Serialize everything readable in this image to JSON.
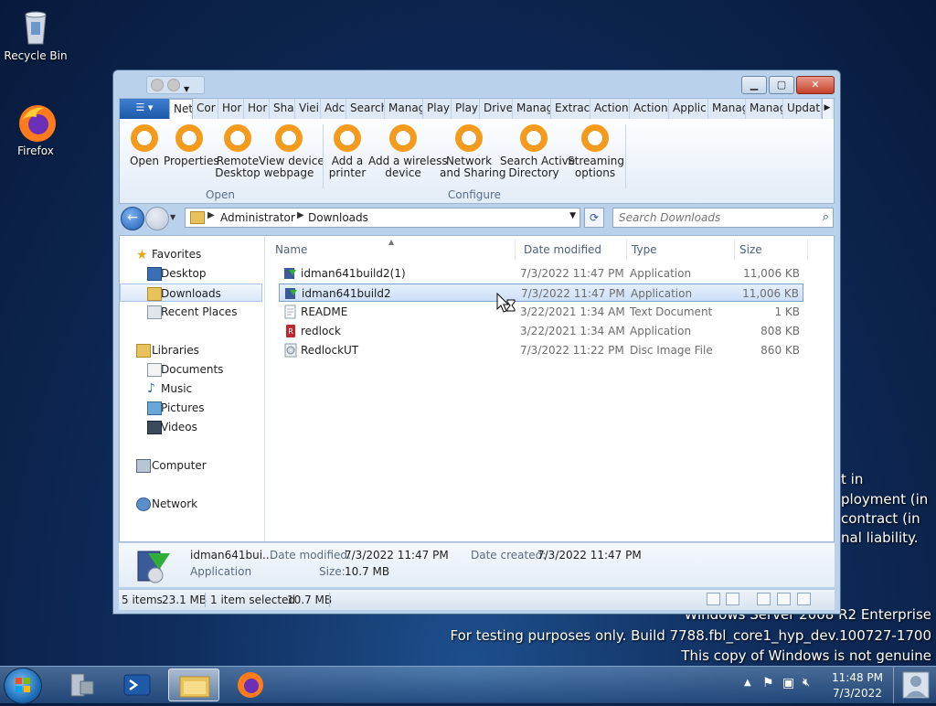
{
  "desktop": {
    "icons": [
      {
        "label": "Recycle Bin"
      },
      {
        "label": "Firefox"
      }
    ],
    "side_text": [
      "t in",
      "ployment (in",
      "contract (in",
      "nal liability."
    ],
    "watermark": [
      "Windows Server 2008 R2 Enterprise",
      "For testing purposes only. Build 7788.fbl_core1_hyp_dev.100727-1700",
      "This copy of Windows is not genuine"
    ]
  },
  "window": {
    "tabs": [
      "Net",
      "Cor",
      "Hor",
      "Hor",
      "Sha",
      "Viei",
      "Adc",
      "Search",
      "Manag",
      "Play",
      "Play",
      "Drive",
      "Manag",
      "Extract",
      "Action",
      "Action",
      "Applic",
      "Manag",
      "Manag",
      "Updat"
    ],
    "ribbon": {
      "groups": [
        {
          "label": "Open",
          "buttons": [
            {
              "label": "Open"
            },
            {
              "label": "Properties"
            },
            {
              "label": "Remote\nDesktop"
            },
            {
              "label": "View device\nwebpage"
            }
          ]
        },
        {
          "label": "Configure",
          "buttons": [
            {
              "label": "Add a\nprinter"
            },
            {
              "label": "Add a wireless\ndevice"
            },
            {
              "label": "Network\nand Sharing"
            },
            {
              "label": "Search Active\nDirectory"
            },
            {
              "label": "Streaming\noptions"
            }
          ]
        }
      ]
    },
    "address": {
      "crumbs": [
        "Administrator",
        "Downloads"
      ],
      "search_placeholder": "Search Downloads"
    },
    "nav": {
      "favorites": "Favorites",
      "desktop": "Desktop",
      "downloads": "Downloads",
      "recent": "Recent Places",
      "libraries": "Libraries",
      "documents": "Documents",
      "music": "Music",
      "pictures": "Pictures",
      "videos": "Videos",
      "computer": "Computer",
      "network": "Network"
    },
    "columns": {
      "name": "Name",
      "date": "Date modified",
      "type": "Type",
      "size": "Size"
    },
    "files": [
      {
        "name": "idman641build2(1)",
        "date": "7/3/2022 11:47 PM",
        "type": "Application",
        "size": "11,006 KB",
        "icon": "installer-icon"
      },
      {
        "name": "idman641build2",
        "date": "7/3/2022 11:47 PM",
        "type": "Application",
        "size": "11,006 KB",
        "icon": "installer-icon"
      },
      {
        "name": "README",
        "date": "3/22/2021 1:34 AM",
        "type": "Text Document",
        "size": "1 KB",
        "icon": "text-file-icon"
      },
      {
        "name": "redlock",
        "date": "3/22/2021 1:34 AM",
        "type": "Application",
        "size": "808 KB",
        "icon": "app-icon"
      },
      {
        "name": "RedlockUT",
        "date": "7/3/2022 11:22 PM",
        "type": "Disc Image File",
        "size": "860 KB",
        "icon": "disc-image-icon"
      }
    ],
    "details": {
      "name": "idman641bui...",
      "type": "Application",
      "modified_label": "Date modified:",
      "modified": "7/3/2022 11:47 PM",
      "created_label": "Date created:",
      "created": "7/3/2022 11:47 PM",
      "size_label": "Size:",
      "size": "10.7 MB"
    },
    "status": {
      "items": "5 items",
      "total": "23.1 MB",
      "selected": "1 item selected",
      "selected_size": "10.7 MB"
    }
  },
  "taskbar": {
    "time": "11:48 PM",
    "date": "7/3/2022"
  },
  "colors": {
    "ribbon_icon": "#f59b1c",
    "selection": "#cde0f7",
    "titlebar": "#b9d1ea"
  }
}
